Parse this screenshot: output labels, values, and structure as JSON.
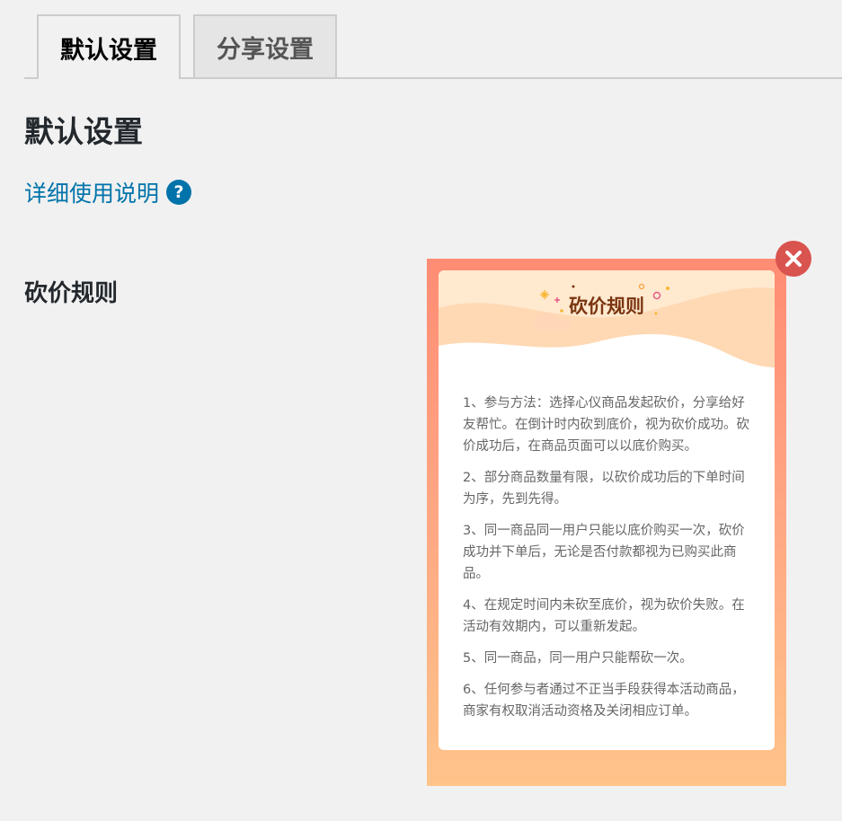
{
  "tabs": [
    {
      "label": "默认设置",
      "active": true
    },
    {
      "label": "分享设置",
      "active": false
    }
  ],
  "page_title": "默认设置",
  "help_link": {
    "label": "详细使用说明",
    "icon": "question-circle-icon",
    "icon_glyph": "?"
  },
  "field_label": "砍价规则",
  "preview": {
    "title": "砍价规则",
    "rules": [
      "1、参与方法：选择心仪商品发起砍价，分享给好友帮忙。在倒计时内砍到底价，视为砍价成功。砍价成功后，在商品页面可以以底价购买。",
      "2、部分商品数量有限，以砍价成功后的下单时间为序，先到先得。",
      "3、同一商品同一用户只能以底价购买一次，砍价成功并下单后，无论是否付款都视为已购买此商品。",
      "4、在规定时间内未砍至底价，视为砍价失败。在活动有效期内，可以重新发起。",
      "5、同一商品，同一用户只能帮砍一次。",
      "6、任何参与者通过不正当手段获得本活动商品，商家有权取消活动资格及关闭相应订单。"
    ]
  },
  "close_button": {
    "icon": "close-icon"
  },
  "colors": {
    "background": "#f1f1f1",
    "link": "#0073aa",
    "close": "#d9534f",
    "gradient_top": "#ff8c74",
    "gradient_bottom": "#ffc48a",
    "card_title": "#7a3510"
  }
}
